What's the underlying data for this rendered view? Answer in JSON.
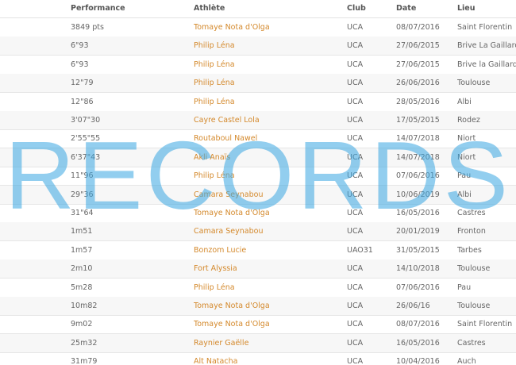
{
  "columns": {
    "performance": "Performance",
    "athlete": "Athlète",
    "club": "Club",
    "date": "Date",
    "lieu": "Lieu"
  },
  "rows": [
    {
      "performance": "3849 pts",
      "athlete": "Tomaye Nota d'Olga",
      "club": "UCA",
      "date": "08/07/2016",
      "lieu": "Saint Florentin"
    },
    {
      "performance": "6\"93",
      "athlete": "Philip Léna",
      "club": "UCA",
      "date": "27/06/2015",
      "lieu": "Brive La Gaillarde"
    },
    {
      "performance": "6\"93",
      "athlete": "Philip Léna",
      "club": "UCA",
      "date": "27/06/2015",
      "lieu": "Brive la Gaillarde"
    },
    {
      "performance": "12\"79",
      "athlete": "Philip Léna",
      "club": "UCA",
      "date": "26/06/2016",
      "lieu": "Toulouse"
    },
    {
      "performance": "12\"86",
      "athlete": "Philip Léna",
      "club": "UCA",
      "date": "28/05/2016",
      "lieu": "Albi"
    },
    {
      "performance": "3'07\"30",
      "athlete": "Cayre Castel Lola",
      "club": "UCA",
      "date": "17/05/2015",
      "lieu": "Rodez"
    },
    {
      "performance": "2'55\"55",
      "athlete": "Routaboul Nawel",
      "club": "UCA",
      "date": "14/07/2018",
      "lieu": "Niort"
    },
    {
      "performance": "6'37\"43",
      "athlete": "Akli Anaïs",
      "club": "UCA",
      "date": "14/07/2018",
      "lieu": "Niort"
    },
    {
      "performance": "11\"96",
      "athlete": "Philip Léna",
      "club": "UCA",
      "date": "07/06/2016",
      "lieu": "Pau"
    },
    {
      "performance": "29\"36",
      "athlete": "Camara Seynabou",
      "club": "UCA",
      "date": "10/06/2019",
      "lieu": "Albi"
    },
    {
      "performance": "31\"64",
      "athlete": "Tomaye Nota d'Olga",
      "club": "UCA",
      "date": "16/05/2016",
      "lieu": "Castres"
    },
    {
      "performance": "1m51",
      "athlete": "Camara Seynabou",
      "club": "UCA",
      "date": "20/01/2019",
      "lieu": "Fronton"
    },
    {
      "performance": "1m57",
      "athlete": "Bonzom Lucie",
      "club": "UAO31",
      "date": "31/05/2015",
      "lieu": "Tarbes"
    },
    {
      "performance": "2m10",
      "athlete": "Fort Alyssia",
      "club": "UCA",
      "date": "14/10/2018",
      "lieu": "Toulouse"
    },
    {
      "performance": "5m28",
      "athlete": "Philip Léna",
      "club": "UCA",
      "date": "07/06/2016",
      "lieu": "Pau"
    },
    {
      "performance": "10m82",
      "athlete": "Tomaye Nota d'Olga",
      "club": "UCA",
      "date": "26/06/16",
      "lieu": "Toulouse"
    },
    {
      "performance": "9m02",
      "athlete": "Tomaye Nota d'Olga",
      "club": "UCA",
      "date": "08/07/2016",
      "lieu": "Saint Florentin"
    },
    {
      "performance": "25m32",
      "athlete": "Raynier Gaëlle",
      "club": "UCA",
      "date": "16/05/2016",
      "lieu": "Castres"
    },
    {
      "performance": "31m79",
      "athlete": "Alt Natacha",
      "club": "UCA",
      "date": "10/04/2016",
      "lieu": "Auch"
    }
  ],
  "watermark": "RECORDS",
  "colors": {
    "athlete_link": "#d4892c",
    "watermark": "#3aa7e2",
    "row_alt": "#f7f7f7"
  }
}
